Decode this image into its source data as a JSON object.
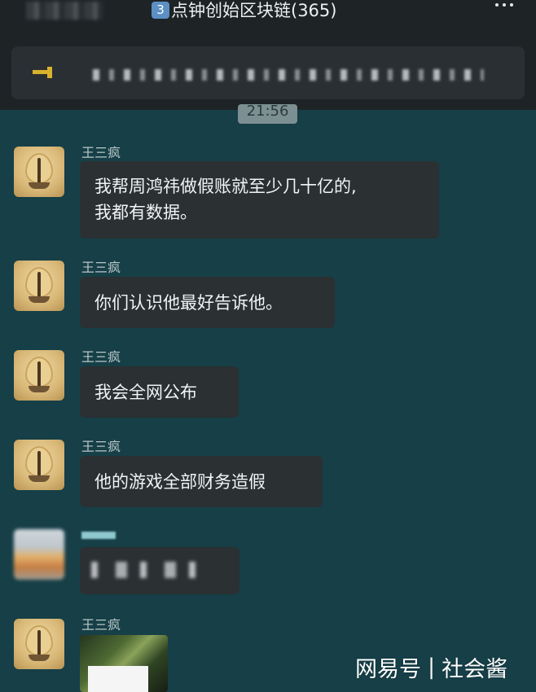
{
  "header": {
    "badge": "3",
    "title": "点钟创始区块链(365)"
  },
  "time_divider": "21:56",
  "messages": [
    {
      "sender": "王三疯",
      "lines": [
        "我帮周鸿祎做假账就至少几十亿的,",
        "我都有数据。"
      ]
    },
    {
      "sender": "王三疯",
      "lines": [
        "你们认识他最好告诉他。"
      ]
    },
    {
      "sender": "王三疯",
      "lines": [
        "我会全网公布"
      ]
    },
    {
      "sender": "王三疯",
      "lines": [
        "他的游戏全部财务造假"
      ]
    },
    {
      "sender": "王三疯",
      "type": "image"
    }
  ],
  "watermark": {
    "left": "网易号",
    "separator": "|",
    "right": "社会酱"
  },
  "colors": {
    "chat_bg": "#163f47",
    "bubble_bg": "#2b3033",
    "topbar_bg": "#1e2326",
    "pin_accent": "#d9b12c"
  }
}
